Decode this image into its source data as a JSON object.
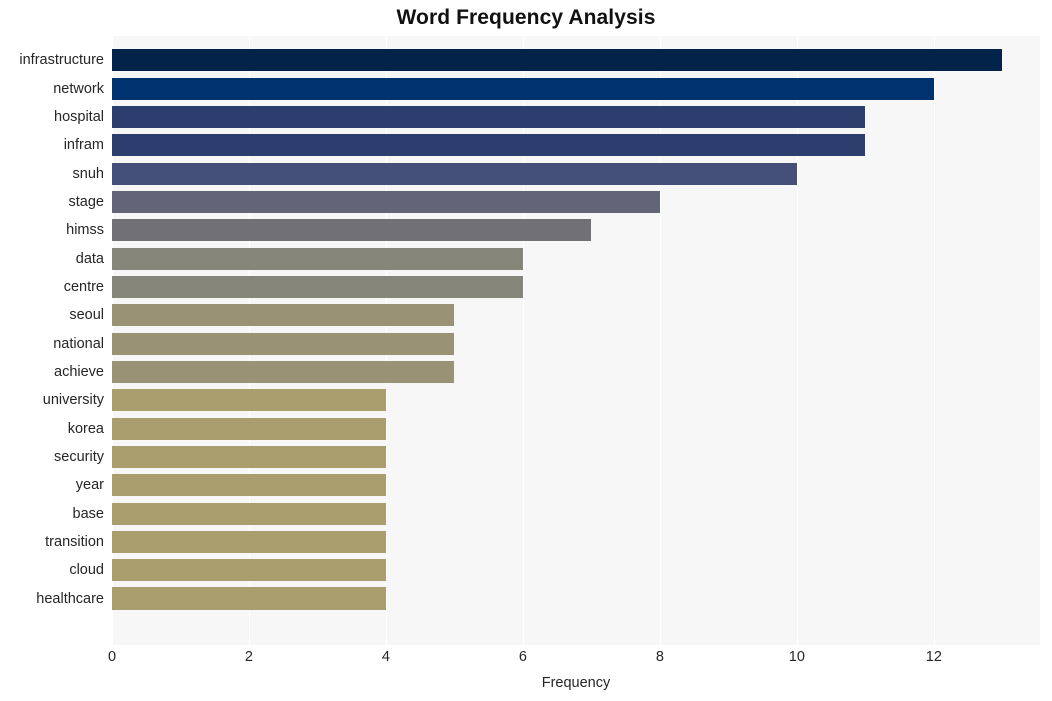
{
  "chart_data": {
    "type": "bar",
    "orientation": "horizontal",
    "title": "Word Frequency Analysis",
    "xlabel": "Frequency",
    "ylabel": "",
    "categories": [
      "infrastructure",
      "network",
      "hospital",
      "infram",
      "snuh",
      "stage",
      "himss",
      "data",
      "centre",
      "seoul",
      "national",
      "achieve",
      "university",
      "korea",
      "security",
      "year",
      "base",
      "transition",
      "cloud",
      "healthcare"
    ],
    "values": [
      13,
      12,
      11,
      11,
      10,
      8,
      7,
      6,
      6,
      5,
      5,
      5,
      4,
      4,
      4,
      4,
      4,
      4,
      4,
      4
    ],
    "bar_colors": [
      "#04234a",
      "#003270",
      "#2b3e6e",
      "#2b3e6e",
      "#44507a",
      "#626477",
      "#717175",
      "#858579",
      "#858579",
      "#999274",
      "#999274",
      "#999274",
      "#aa9e6f",
      "#aa9e6f",
      "#aa9e6f",
      "#aa9e6f",
      "#aa9e6f",
      "#aa9e6f",
      "#aa9e6f",
      "#aa9e6f"
    ],
    "xticks": [
      0,
      2,
      4,
      6,
      8,
      10,
      12
    ],
    "xtick_labels": [
      "0",
      "2",
      "4",
      "6",
      "8",
      "10",
      "12"
    ],
    "xlim": [
      0,
      13.55
    ],
    "grid": {
      "vertical": true,
      "horizontal": false,
      "color": "#ffffff"
    },
    "legend": null,
    "plot_background": "#f7f7f7",
    "figure_background": "#ffffff",
    "text_color": "#262626"
  }
}
